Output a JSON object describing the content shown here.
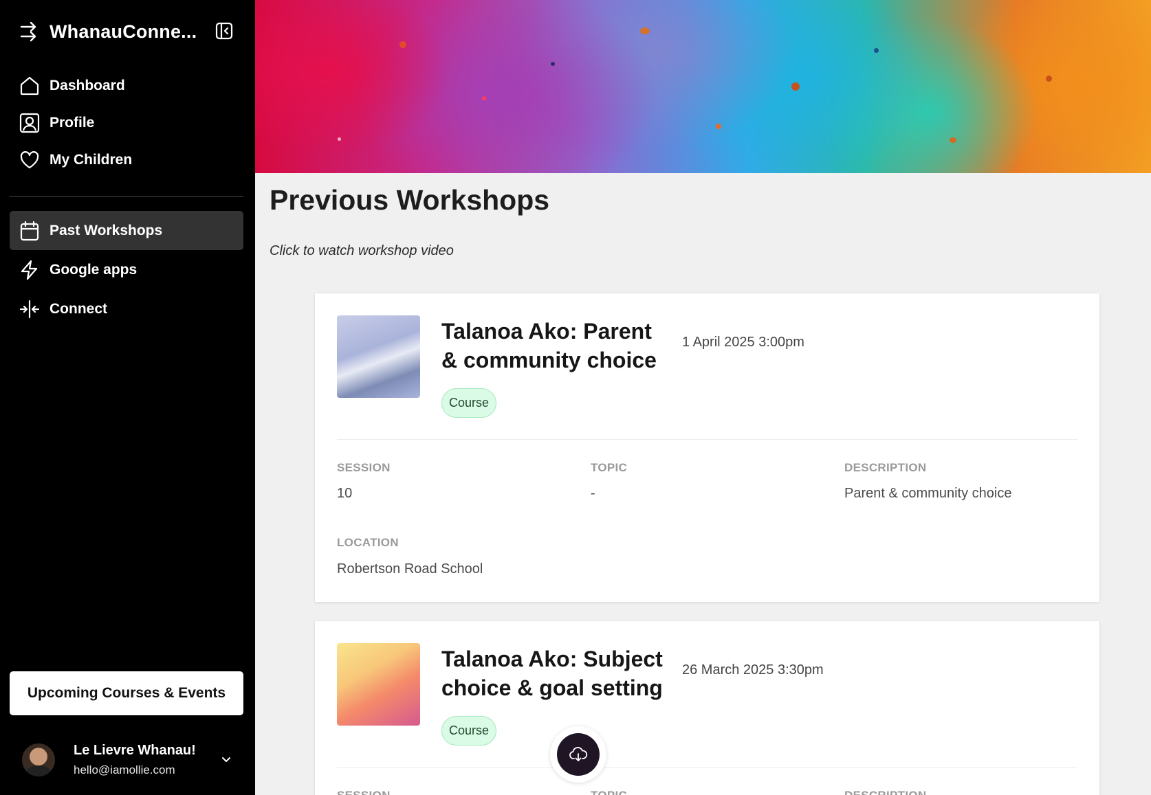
{
  "app": {
    "name": "WhanauConne...",
    "logo_icon": "arrow-right-in-icon",
    "collapse_icon": "sidebar-collapse-icon"
  },
  "sidebar": {
    "nav_top": [
      {
        "label": "Dashboard",
        "icon": "home-icon"
      },
      {
        "label": "Profile",
        "icon": "user-square-icon"
      },
      {
        "label": "My Children",
        "icon": "heart-icon"
      }
    ],
    "nav_bottom": [
      {
        "label": "Past Workshops",
        "icon": "calendar-icon",
        "active": true
      },
      {
        "label": "Google apps",
        "icon": "lightning-icon"
      },
      {
        "label": "Connect",
        "icon": "connect-arrows-icon"
      }
    ],
    "upcoming_button": "Upcoming Courses & Events",
    "user": {
      "name": "Le Lievre Whanau!",
      "email": "hello@iamollie.com"
    }
  },
  "main": {
    "title": "Previous Workshops",
    "hint": "Click to watch workshop video",
    "workshops": [
      {
        "title": "Talanoa Ako: Parent & community choice",
        "date": "1 April 2025 3:00pm",
        "badge": "Course",
        "labels": {
          "session": "SESSION",
          "topic": "TOPIC",
          "description": "DESCRIPTION",
          "location": "LOCATION"
        },
        "session": "10",
        "topic": "-",
        "description": "Parent & community choice",
        "location": "Robertson Road School"
      },
      {
        "title": "Talanoa Ako: Subject choice & goal setting",
        "date": "26 March 2025 3:30pm",
        "badge": "Course",
        "labels": {
          "session": "SESSION",
          "topic": "TOPIC",
          "description": "DESCRIPTION"
        }
      }
    ]
  },
  "fab": {
    "icon": "cloud-download-icon"
  },
  "colors": {
    "sidebar_bg": "#000000",
    "active_nav_bg": "#333333",
    "page_bg": "#f0f0f0",
    "badge_bg": "#dafbe6",
    "badge_border": "#a4e8bd",
    "fab_bg": "#1f1525"
  }
}
